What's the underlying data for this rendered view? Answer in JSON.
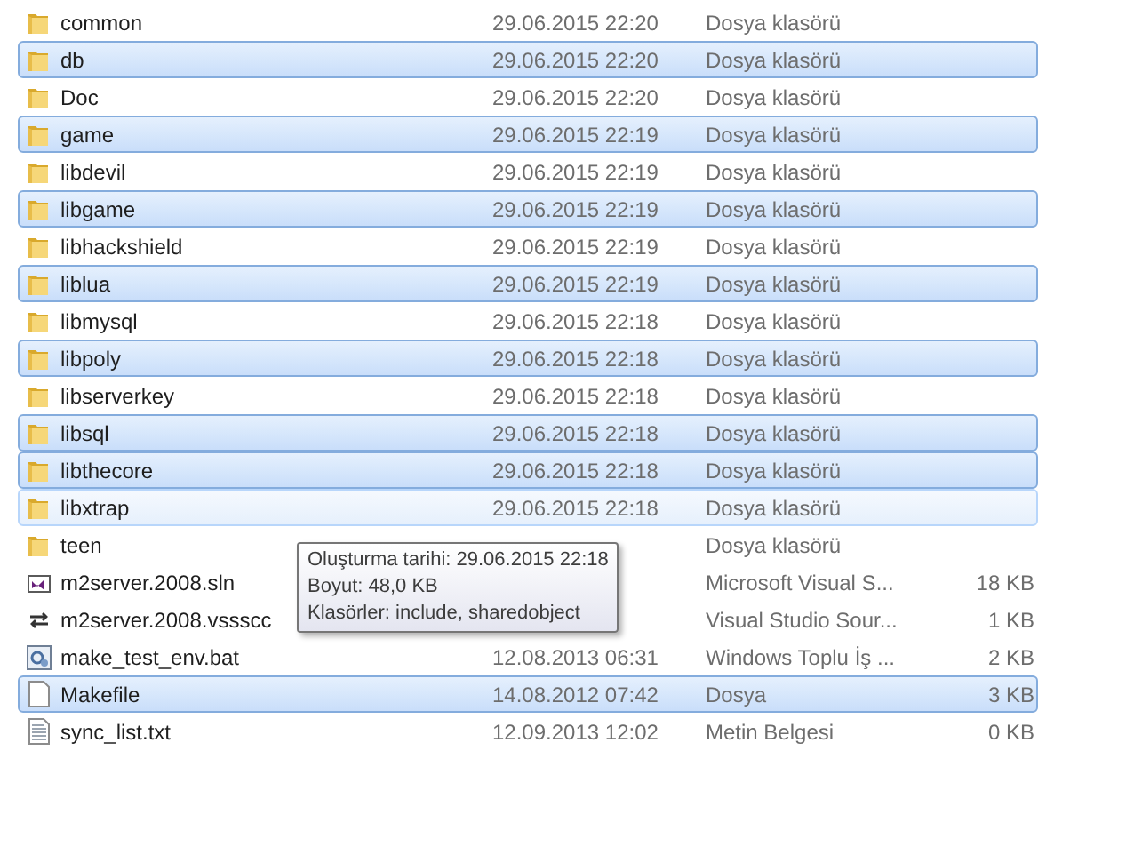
{
  "files": [
    {
      "name": "common",
      "date": "29.06.2015 22:20",
      "type": "Dosya klasörü",
      "kind": "folder",
      "selected": false,
      "hovered": false
    },
    {
      "name": "db",
      "date": "29.06.2015 22:20",
      "type": "Dosya klasörü",
      "kind": "folder",
      "selected": true,
      "hovered": false
    },
    {
      "name": "Doc",
      "date": "29.06.2015 22:20",
      "type": "Dosya klasörü",
      "kind": "folder",
      "selected": false,
      "hovered": false
    },
    {
      "name": "game",
      "date": "29.06.2015 22:19",
      "type": "Dosya klasörü",
      "kind": "folder",
      "selected": true,
      "hovered": false
    },
    {
      "name": "libdevil",
      "date": "29.06.2015 22:19",
      "type": "Dosya klasörü",
      "kind": "folder",
      "selected": false,
      "hovered": false
    },
    {
      "name": "libgame",
      "date": "29.06.2015 22:19",
      "type": "Dosya klasörü",
      "kind": "folder",
      "selected": true,
      "hovered": false
    },
    {
      "name": "libhackshield",
      "date": "29.06.2015 22:19",
      "type": "Dosya klasörü",
      "kind": "folder",
      "selected": false,
      "hovered": false
    },
    {
      "name": "liblua",
      "date": "29.06.2015 22:19",
      "type": "Dosya klasörü",
      "kind": "folder",
      "selected": true,
      "hovered": false
    },
    {
      "name": "libmysql",
      "date": "29.06.2015 22:18",
      "type": "Dosya klasörü",
      "kind": "folder",
      "selected": false,
      "hovered": false
    },
    {
      "name": "libpoly",
      "date": "29.06.2015 22:18",
      "type": "Dosya klasörü",
      "kind": "folder",
      "selected": true,
      "hovered": false
    },
    {
      "name": "libserverkey",
      "date": "29.06.2015 22:18",
      "type": "Dosya klasörü",
      "kind": "folder",
      "selected": false,
      "hovered": false
    },
    {
      "name": "libsql",
      "date": "29.06.2015 22:18",
      "type": "Dosya klasörü",
      "kind": "folder",
      "selected": true,
      "hovered": false
    },
    {
      "name": "libthecore",
      "date": "29.06.2015 22:18",
      "type": "Dosya klasörü",
      "kind": "folder",
      "selected": true,
      "hovered": false
    },
    {
      "name": "libxtrap",
      "date": "29.06.2015 22:18",
      "type": "Dosya klasörü",
      "kind": "folder",
      "selected": false,
      "hovered": true
    },
    {
      "name": "teen",
      "type": "Dosya klasörü",
      "kind": "folder",
      "selected": false,
      "hovered": false
    },
    {
      "name": "m2server.2008.sln",
      "type": "Microsoft Visual S...",
      "size": "18 KB",
      "kind": "sln",
      "selected": false,
      "hovered": false
    },
    {
      "name": "m2server.2008.vssscc",
      "type": "Visual Studio Sour...",
      "size": "1 KB",
      "kind": "vssscc",
      "selected": false,
      "hovered": false
    },
    {
      "name": "make_test_env.bat",
      "date": "12.08.2013 06:31",
      "type": "Windows Toplu İş ...",
      "size": "2 KB",
      "kind": "bat",
      "selected": false,
      "hovered": false
    },
    {
      "name": "Makefile",
      "date": "14.08.2012 07:42",
      "type": "Dosya",
      "size": "3 KB",
      "kind": "file",
      "selected": true,
      "hovered": false
    },
    {
      "name": "sync_list.txt",
      "date": "12.09.2013 12:02",
      "type": "Metin Belgesi",
      "size": "0 KB",
      "kind": "txt",
      "selected": false,
      "hovered": false
    }
  ],
  "tooltip": {
    "lines": [
      "Oluşturma tarihi: 29.06.2015 22:18",
      "Boyut: 48,0 KB",
      "Klasörler: include, sharedobject"
    ]
  }
}
